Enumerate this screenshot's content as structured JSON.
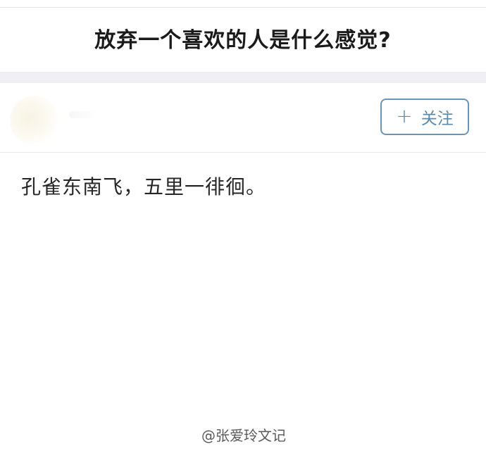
{
  "question": {
    "title": "放弃一个喜欢的人是什么感觉?"
  },
  "author": {
    "follow_label": "关注",
    "follow_icon": "plus-icon"
  },
  "answer": {
    "text": "孔雀东南飞，五里一徘徊。"
  },
  "watermark": {
    "text": "@张爱玲文记"
  },
  "colors": {
    "follow_accent": "#5c8aad",
    "band": "#efeff5"
  }
}
